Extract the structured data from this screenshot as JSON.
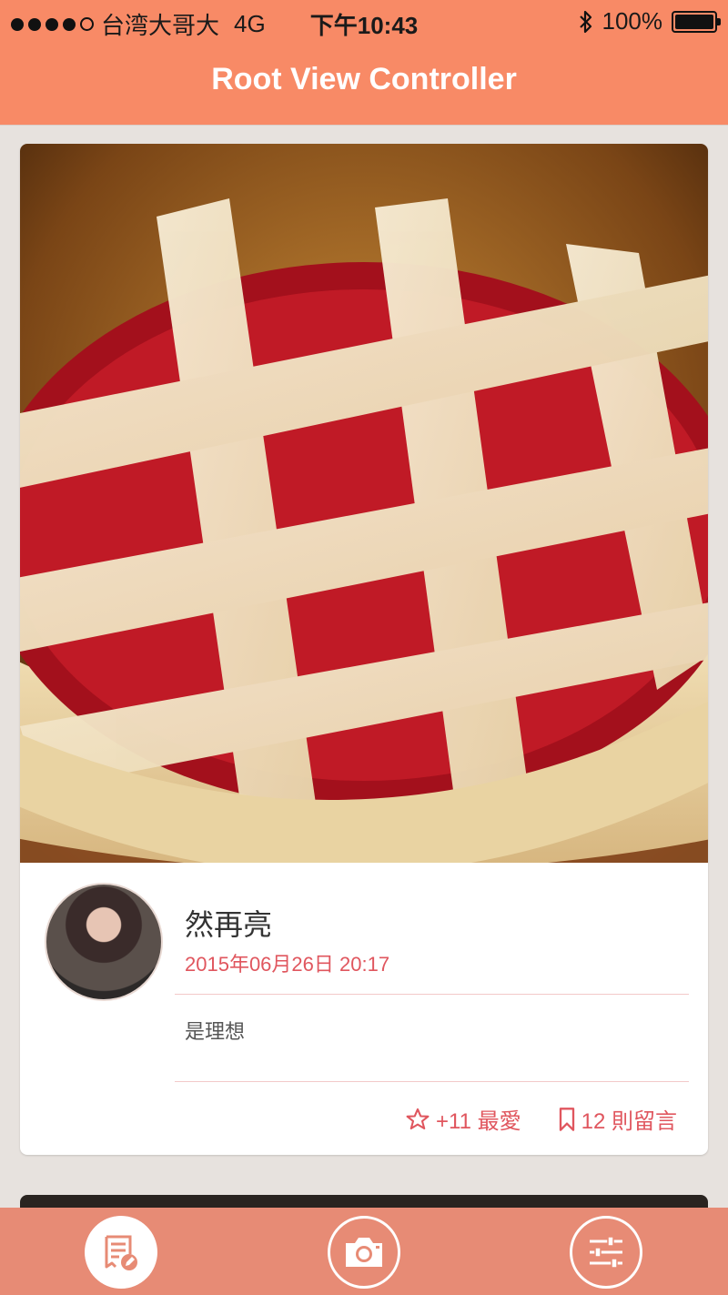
{
  "status_bar": {
    "carrier": "台湾大哥大",
    "network": "4G",
    "time": "下午10:43",
    "battery": "100%"
  },
  "nav": {
    "title": "Root View Controller"
  },
  "post": {
    "author": "然再亮",
    "date": "2015年06月26日 20:17",
    "content": "是理想",
    "likes_label": "+11 最愛",
    "comments_label": "12 則留言"
  },
  "tabs": [
    {
      "icon": "edit-note-icon"
    },
    {
      "icon": "camera-icon"
    },
    {
      "icon": "settings-sliders-icon"
    }
  ],
  "colors": {
    "header": "#f88a66",
    "tabbar": "#e78b75",
    "accent": "#e0565e",
    "background": "#e7e2de"
  }
}
